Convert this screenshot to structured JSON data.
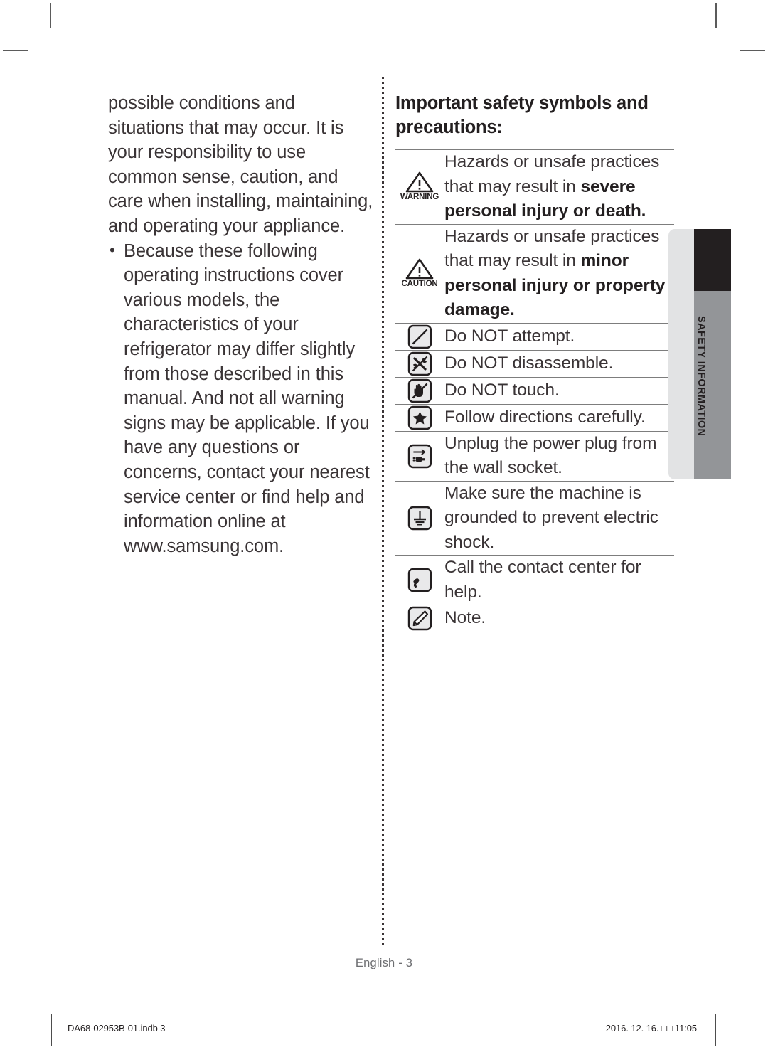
{
  "left_column": {
    "paragraphs": [
      {
        "bullet": false,
        "text": "possible conditions and situations that may occur. It is your responsibility to use common sense, caution, and care when installing, maintaining, and operating your appliance."
      },
      {
        "bullet": true,
        "text": "Because these following operating instructions cover various models, the characteristics of your refrigerator may differ slightly from those described in this manual. And not all warning signs may be applicable. If you have any questions or concerns, contact your nearest service center or find help and information online at www.samsung.com."
      }
    ]
  },
  "right_column": {
    "heading": "Important safety symbols and precautions:",
    "rows": [
      {
        "icon": "warning-triangle-icon",
        "icon_label": "WARNING",
        "text_plain": "Hazards or unsafe practices that may result in severe personal injury or death.",
        "text_normal": "Hazards or unsafe practices that may result in ",
        "text_bold": "severe personal injury or death."
      },
      {
        "icon": "caution-triangle-icon",
        "icon_label": "CAUTION",
        "text_plain": "Hazards or unsafe practices that may result in minor personal injury or property damage.",
        "text_normal": "Hazards or unsafe practices that may result in ",
        "text_bold": "minor personal injury or property damage."
      },
      {
        "icon": "do-not-attempt-icon",
        "icon_label": "",
        "text_plain": "Do NOT attempt."
      },
      {
        "icon": "do-not-disassemble-icon",
        "icon_label": "",
        "text_plain": "Do NOT disassemble."
      },
      {
        "icon": "do-not-touch-icon",
        "icon_label": "",
        "text_plain": "Do NOT touch."
      },
      {
        "icon": "follow-directions-star-icon",
        "icon_label": "",
        "text_plain": "Follow directions carefully."
      },
      {
        "icon": "unplug-power-plug-icon",
        "icon_label": "",
        "text_plain": "Unplug the power plug from the wall socket."
      },
      {
        "icon": "ground-earth-icon",
        "icon_label": "",
        "text_plain": "Make sure the machine is grounded to prevent electric shock."
      },
      {
        "icon": "telephone-handset-icon",
        "icon_label": "",
        "text_plain": "Call the contact center for help."
      },
      {
        "icon": "note-pencil-icon",
        "icon_label": "",
        "text_plain": "Note."
      }
    ]
  },
  "side_tab": {
    "label": "SAFETY INFORMATION"
  },
  "footer": {
    "page_label": "English - 3"
  },
  "print_footer": {
    "file_name": "DA68-02953B-01.indb   3",
    "timestamp": "2016. 12. 16.   □□ 11:05"
  },
  "colors": {
    "body_text": "#3a3436",
    "heading_text": "#231f20",
    "rule": "#7d7d7d",
    "tab_light": "#e2e3e4",
    "tab_dark": "#231f20",
    "tab_grey": "#939598",
    "footer_text": "#6d6e71"
  }
}
